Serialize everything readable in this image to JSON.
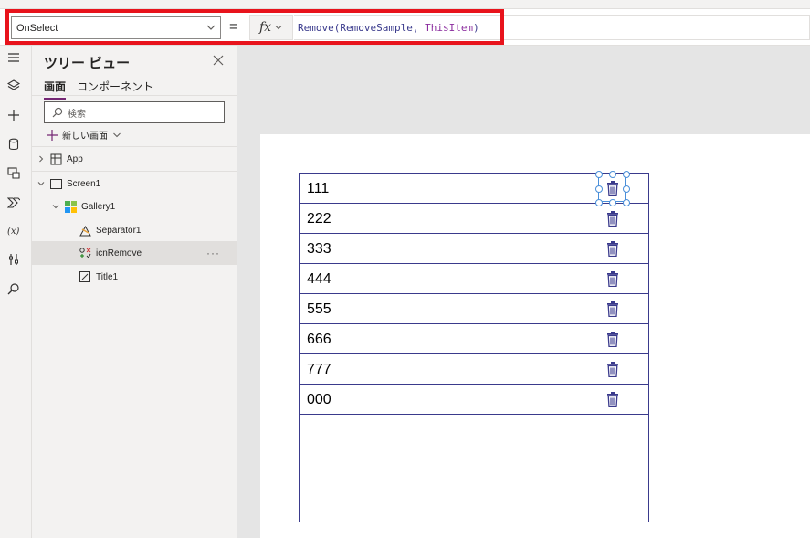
{
  "formula_bar": {
    "property": "OnSelect",
    "equals": "=",
    "fx_label": "fx",
    "formula_func": "Remove(RemoveSample, ",
    "formula_keyword": "ThisItem",
    "formula_end": ")"
  },
  "tree_view": {
    "title": "ツリー ビュー",
    "tabs": [
      {
        "label": "画面",
        "selected": true
      },
      {
        "label": "コンポーネント",
        "selected": false
      }
    ],
    "search_placeholder": "検索",
    "new_screen_label": "新しい画面",
    "nodes": [
      {
        "label": "App",
        "icon": "app-icon"
      },
      {
        "label": "Screen1",
        "icon": "screen-icon"
      },
      {
        "label": "Gallery1",
        "icon": "gallery-icon"
      },
      {
        "label": "Separator1",
        "icon": "separator-icon"
      },
      {
        "label": "icnRemove",
        "icon": "icons-icon",
        "selected": true,
        "more": "···"
      },
      {
        "label": "Title1",
        "icon": "label-icon"
      }
    ]
  },
  "gallery": {
    "items": [
      "111",
      "222",
      "333",
      "444",
      "555",
      "666",
      "777",
      "000"
    ],
    "selected_item_index": 0
  },
  "colors": {
    "accent": "#742774",
    "gallery_border": "#3a3a8c",
    "highlight": "#e8131c",
    "selection": "#4a8fd9"
  }
}
